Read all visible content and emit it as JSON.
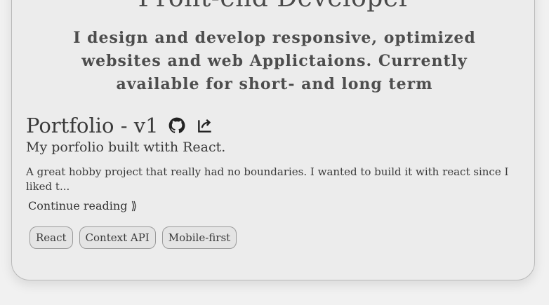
{
  "hero": {
    "title": "Front-end Developer",
    "subtitle": "I design and develop responsive, optimized websites and web Applictaions. Currently available for short- and long term"
  },
  "project": {
    "title": "Portfolio - v1",
    "subtitle": "My porfolio built wtith React.",
    "description": "A great hobby project that really had no boundaries. I wanted to build it with react since I liked t...",
    "continue_label": "Continue reading ⟫",
    "github_icon": "github-icon",
    "external_icon": "external-link-icon",
    "tags": [
      "React",
      "Context API",
      "Mobile-first"
    ]
  }
}
